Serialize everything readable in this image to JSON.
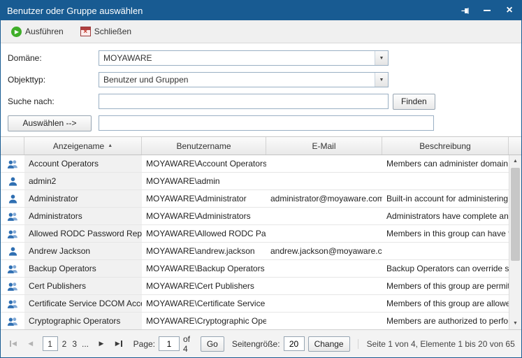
{
  "window": {
    "title": "Benutzer oder Gruppe auswählen"
  },
  "toolbar": {
    "run_label": "Ausführen",
    "close_label": "Schließen"
  },
  "form": {
    "domain_label": "Domäne:",
    "domain_value": "MOYAWARE",
    "objecttype_label": "Objekttyp:",
    "objecttype_value": "Benutzer und Gruppen",
    "search_label": "Suche nach:",
    "search_value": "",
    "find_label": "Finden",
    "select_label": "Auswählen -->",
    "selected_value": ""
  },
  "table": {
    "columns": {
      "name": "Anzeigename",
      "username": "Benutzername",
      "email": "E-Mail",
      "description": "Beschreibung"
    },
    "sort": {
      "column": "Anzeigename",
      "direction": "ascending"
    },
    "rows": [
      {
        "icon": "group",
        "name": "Account Operators",
        "username": "MOYAWARE\\Account Operators",
        "email": "",
        "description": "Members can administer domain user and group accounts"
      },
      {
        "icon": "user",
        "name": "admin2",
        "username": "MOYAWARE\\admin",
        "email": "",
        "description": ""
      },
      {
        "icon": "user",
        "name": "Administrator",
        "username": "MOYAWARE\\Administrator",
        "email": "administrator@moyaware.com",
        "description": "Built-in account for administering the computer/domain"
      },
      {
        "icon": "group",
        "name": "Administrators",
        "username": "MOYAWARE\\Administrators",
        "email": "",
        "description": "Administrators have complete and unrestricted access to the computer/domain"
      },
      {
        "icon": "group",
        "name": "Allowed RODC Password Replication Group",
        "username": "MOYAWARE\\Allowed RODC Password Replication Group",
        "email": "",
        "description": "Members in this group can have their passwords replicated to all read-only domain controllers"
      },
      {
        "icon": "user",
        "name": "Andrew Jackson",
        "username": "MOYAWARE\\andrew.jackson",
        "email": "andrew.jackson@moyaware.com",
        "description": ""
      },
      {
        "icon": "group",
        "name": "Backup Operators",
        "username": "MOYAWARE\\Backup Operators",
        "email": "",
        "description": "Backup Operators can override security restrictions for the sole purpose of backing up or restoring"
      },
      {
        "icon": "group",
        "name": "Cert Publishers",
        "username": "MOYAWARE\\Cert Publishers",
        "email": "",
        "description": "Members of this group are permitted to publish certificates to the directory"
      },
      {
        "icon": "group",
        "name": "Certificate Service DCOM Access",
        "username": "MOYAWARE\\Certificate Service DCOM Access",
        "email": "",
        "description": "Members of this group are allowed to connect to Certification Authorities"
      },
      {
        "icon": "group",
        "name": "Cryptographic Operators",
        "username": "MOYAWARE\\Cryptographic Operators",
        "email": "",
        "description": "Members are authorized to perform cryptographic operations."
      }
    ]
  },
  "pagination": {
    "pages": [
      {
        "label": "1",
        "current": true
      },
      {
        "label": "2",
        "current": false
      },
      {
        "label": "3",
        "current": false
      },
      {
        "label": "...",
        "current": false
      }
    ],
    "page_label": "Page:",
    "page_value": "1",
    "of_label": "of 4",
    "go_label": "Go",
    "size_label": "Seitengröße:",
    "size_value": "20",
    "change_label": "Change",
    "status": "Seite 1 von 4, Elemente 1 bis 20 von 65."
  },
  "icons": {
    "play": "▶",
    "close_red_x": "×",
    "minimize": "–",
    "close_x": "×",
    "dropdown_arrow": "▼",
    "sort_ascending": "▲",
    "scroll_up": "▲",
    "scroll_down": "▼",
    "prev_arrow": "◀",
    "next_arrow": "▶"
  },
  "colors": {
    "titlebar_blue": "#185b92",
    "run_green": "#3fae29",
    "close_red": "#c0392b",
    "sorted_column_bg": "#f1f1f1"
  }
}
